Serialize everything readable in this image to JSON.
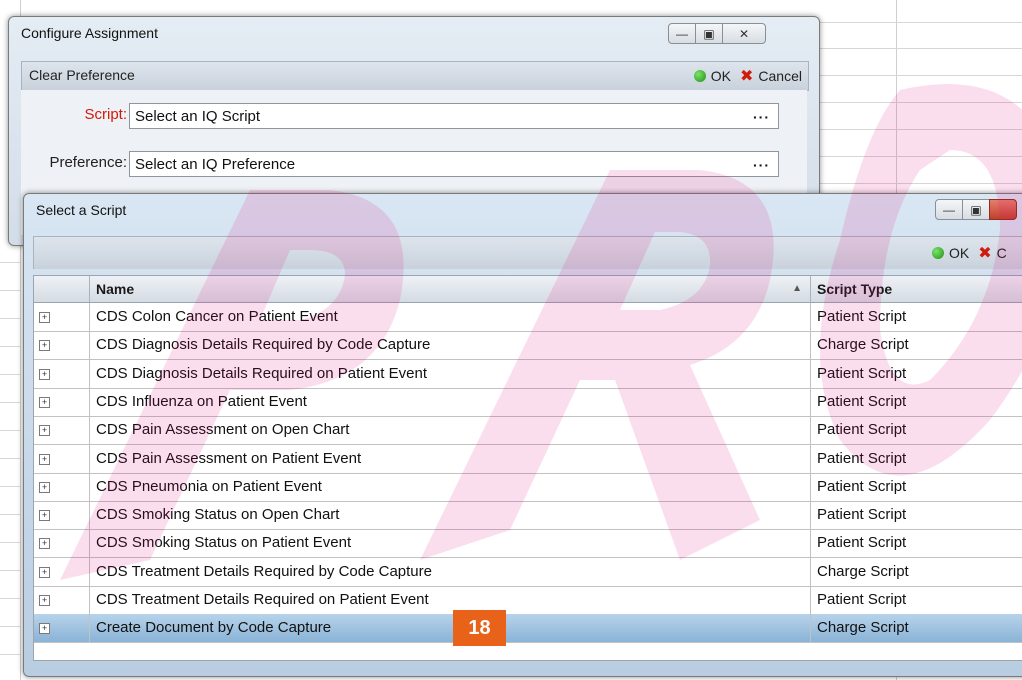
{
  "configure_window": {
    "title": "Configure Assignment",
    "header_label": "Clear Preference",
    "ok_label": "OK",
    "cancel_label": "Cancel",
    "script_label": "Script:",
    "script_value": "Select an IQ Script",
    "preference_label": "Preference:",
    "preference_value": "Select an IQ Preference",
    "ellipsis": "···"
  },
  "select_window": {
    "title": "Select a Script",
    "ok_label": "OK",
    "cancel_label": "C",
    "columns": [
      "Name",
      "Script Type"
    ],
    "rows": [
      {
        "name": "CDS Colon Cancer on Patient Event",
        "type": "Patient Script"
      },
      {
        "name": "CDS Diagnosis Details Required by Code Capture",
        "type": "Charge Script"
      },
      {
        "name": "CDS Diagnosis Details Required on Patient Event",
        "type": "Patient Script"
      },
      {
        "name": "CDS Influenza on Patient Event",
        "type": "Patient Script"
      },
      {
        "name": "CDS Pain Assessment on Open Chart",
        "type": "Patient Script"
      },
      {
        "name": "CDS Pain Assessment on Patient Event",
        "type": "Patient Script"
      },
      {
        "name": "CDS Pneumonia on Patient Event",
        "type": "Patient Script"
      },
      {
        "name": "CDS Smoking Status on Open Chart",
        "type": "Patient Script"
      },
      {
        "name": "CDS Smoking Status on Patient Event",
        "type": "Patient Script"
      },
      {
        "name": "CDS Treatment Details Required by Code Capture",
        "type": "Charge Script"
      },
      {
        "name": "CDS Treatment Details Required on Patient Event",
        "type": "Patient Script"
      },
      {
        "name": "Create Document by Code Capture",
        "type": "Charge Script",
        "selected": true
      }
    ]
  },
  "step_badge": "18",
  "colors": {
    "accent_badge": "#e8621a",
    "selected_row": "#9fc2e0",
    "required_label": "#d11b0b"
  },
  "icons": [
    "minimize-icon",
    "maximize-icon",
    "close-icon",
    "ok-icon",
    "cancel-icon",
    "expand-icon",
    "sort-ascending-icon"
  ]
}
